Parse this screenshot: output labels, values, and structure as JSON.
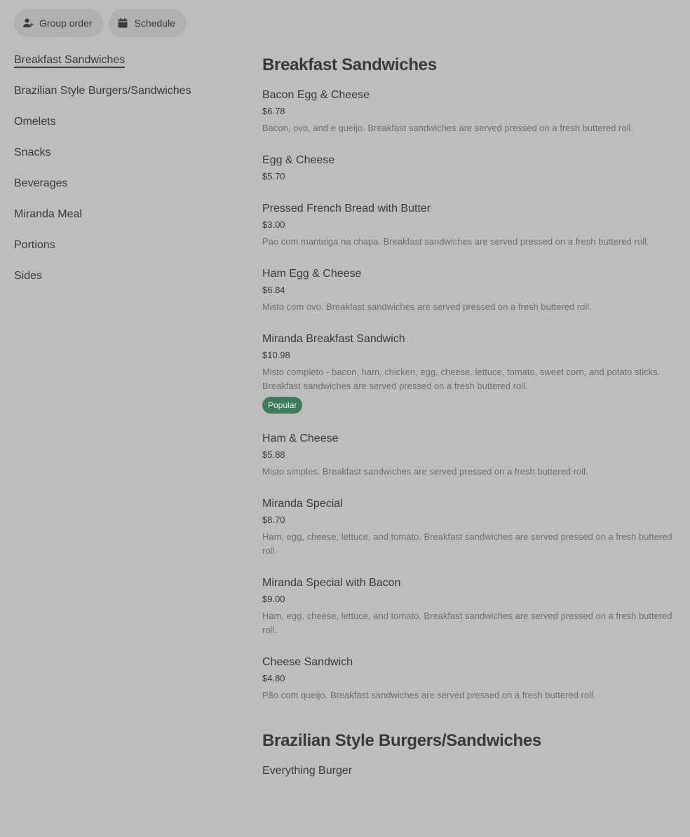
{
  "topbar": {
    "group_order": {
      "label": "Group order",
      "icon": "person-add-icon"
    },
    "schedule": {
      "label": "Schedule",
      "icon": "calendar-icon"
    }
  },
  "sidebar": {
    "items": [
      {
        "label": "Breakfast Sandwiches",
        "active": true
      },
      {
        "label": "Brazilian Style Burgers/Sandwiches"
      },
      {
        "label": "Omelets"
      },
      {
        "label": "Snacks"
      },
      {
        "label": "Beverages"
      },
      {
        "label": "Miranda Meal"
      },
      {
        "label": "Portions"
      },
      {
        "label": "Sides"
      }
    ]
  },
  "sections": [
    {
      "title": "Breakfast Sandwiches",
      "items": [
        {
          "name": "Bacon Egg & Cheese",
          "price": "$6.78",
          "desc": "Bacon, ovo, and e queijo. Breakfast sandwiches are served pressed on a fresh buttered roll."
        },
        {
          "name": "Egg & Cheese",
          "price": "$5.70",
          "desc": ""
        },
        {
          "name": "Pressed French Bread with Butter",
          "price": "$3.00",
          "desc": "Pao com manteiga na chapa. Breakfast sandwiches are served pressed on a fresh buttered roll."
        },
        {
          "name": "Ham Egg & Cheese",
          "price": "$6.84",
          "desc": "Misto com ovo. Breakfast sandwiches are served pressed on a fresh buttered roll."
        },
        {
          "name": "Miranda Breakfast Sandwich",
          "price": "$10.98",
          "desc": "Misto completo - bacon, ham, chicken, egg, cheese, lettuce, tomato, sweet corn, and potato sticks. Breakfast sandwiches are served pressed on a fresh buttered roll.",
          "badge": "Popular"
        },
        {
          "name": "Ham & Cheese",
          "price": "$5.88",
          "desc": "Misto simples. Breakfast sandwiches are served pressed on a fresh buttered roll."
        },
        {
          "name": "Miranda Special",
          "price": "$8.70",
          "desc": "Ham, egg, cheese, lettuce, and tomato. Breakfast sandwiches are served pressed on a fresh buttered roll."
        },
        {
          "name": "Miranda Special with Bacon",
          "price": "$9.00",
          "desc": "Ham, egg, cheese, lettuce, and tomato. Breakfast sandwiches are served pressed on a fresh buttered roll."
        },
        {
          "name": "Cheese Sandwich",
          "price": "$4.80",
          "desc": "Pão com queijo. Breakfast sandwiches are served pressed on a fresh buttered roll."
        }
      ]
    },
    {
      "title": "Brazilian Style Burgers/Sandwiches",
      "items": [
        {
          "name": "Everything Burger",
          "price": "",
          "desc": ""
        }
      ]
    }
  ],
  "colors": {
    "background": "#bdbdbd",
    "pill": "#b0b0b0",
    "text": "#3a3a3a",
    "muted": "#6f6f6f",
    "badge": "#3f7a5d"
  }
}
